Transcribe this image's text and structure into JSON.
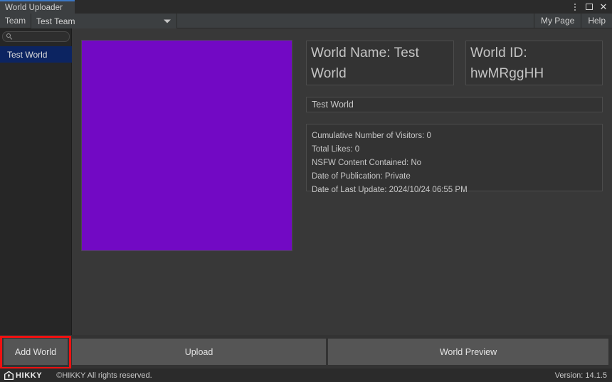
{
  "window": {
    "tab_label": "World Uploader",
    "controls": {
      "menu_icon": "kebab-menu-icon",
      "maximize_icon": "maximize-icon",
      "close_icon": "close-icon"
    }
  },
  "toolbar": {
    "team_label": "Team",
    "team_selected": "Test Team",
    "team_options": [
      "Test Team"
    ],
    "my_page_label": "My Page",
    "help_label": "Help"
  },
  "sidebar": {
    "search_value": "",
    "search_placeholder": "",
    "search_icon": "search-icon",
    "items": [
      {
        "label": "Test World",
        "selected": true
      }
    ]
  },
  "main": {
    "thumbnail": {
      "name": "world-thumbnail",
      "color": "#7209c4"
    },
    "world_name": "World Name: Test World",
    "world_id": "World ID: hwMRggHH",
    "description": "Test World",
    "stats": [
      "Cumulative Number of Visitors: 0",
      "Total Likes: 0",
      "NSFW Content Contained: No",
      "Date of Publication: Private",
      "Date of Last Update: 2024/10/24 06:55 PM"
    ]
  },
  "actions": {
    "add_world_label": "Add World",
    "upload_label": "Upload",
    "preview_label": "World Preview",
    "highlight_color": "#ee1111"
  },
  "status": {
    "logo_text": "HIKKY",
    "logo_icon": "hikky-house-logo-icon",
    "copyright": "©HIKKY All rights reserved.",
    "version": "Version: 14.1.5"
  }
}
